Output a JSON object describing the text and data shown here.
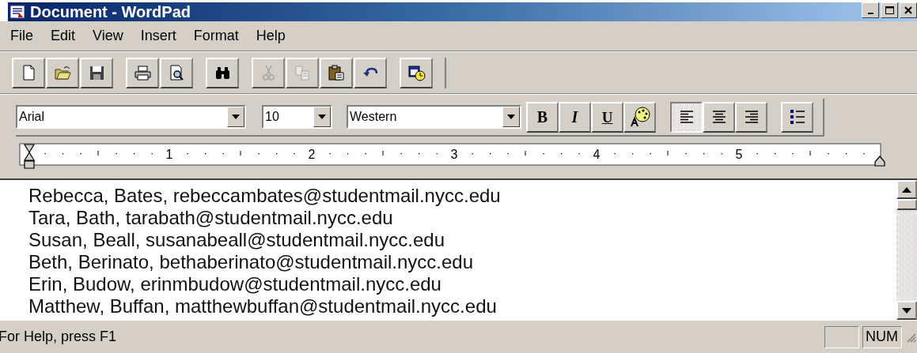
{
  "window": {
    "title": "Document - WordPad"
  },
  "menu": [
    "File",
    "Edit",
    "View",
    "Insert",
    "Format",
    "Help"
  ],
  "toolbar": [
    {
      "kind": "new",
      "disabled": false
    },
    {
      "kind": "open",
      "disabled": false
    },
    {
      "kind": "save",
      "disabled": false
    },
    {
      "kind": "sep"
    },
    {
      "kind": "print",
      "disabled": false
    },
    {
      "kind": "preview",
      "disabled": false
    },
    {
      "kind": "sep"
    },
    {
      "kind": "find",
      "disabled": false
    },
    {
      "kind": "sep"
    },
    {
      "kind": "cut",
      "disabled": true
    },
    {
      "kind": "copy",
      "disabled": true
    },
    {
      "kind": "paste",
      "disabled": false
    },
    {
      "kind": "undo",
      "disabled": false
    },
    {
      "kind": "sep"
    },
    {
      "kind": "datetime",
      "disabled": false
    }
  ],
  "format_bar": {
    "font": "Arial",
    "size": "10",
    "script": "Western",
    "style_buttons": [
      {
        "kind": "bold",
        "label": "B",
        "selected": false
      },
      {
        "kind": "italic",
        "label": "I",
        "selected": false
      },
      {
        "kind": "underline",
        "label": "U",
        "selected": false
      },
      {
        "kind": "color",
        "selected": false
      }
    ],
    "align_buttons": [
      {
        "kind": "left",
        "selected": true
      },
      {
        "kind": "center",
        "selected": false
      },
      {
        "kind": "right",
        "selected": false
      }
    ],
    "bullets": {
      "selected": false
    }
  },
  "ruler": {
    "numbers": [
      "1",
      "2",
      "3",
      "4",
      "5"
    ]
  },
  "document": {
    "lines": [
      "Rebecca, Bates, rebeccambates@studentmail.nycc.edu",
      "Tara, Bath, tarabath@studentmail.nycc.edu",
      "Susan, Beall, susanabeall@studentmail.nycc.edu",
      "Beth, Berinato, bethaberinato@studentmail.nycc.edu",
      "Erin, Budow, erinmbudow@studentmail.nycc.edu",
      "Matthew, Buffan, matthewbuffan@studentmail.nycc.edu"
    ]
  },
  "status_bar": {
    "text": "For Help, press F1",
    "panels": [
      "NUM"
    ]
  }
}
